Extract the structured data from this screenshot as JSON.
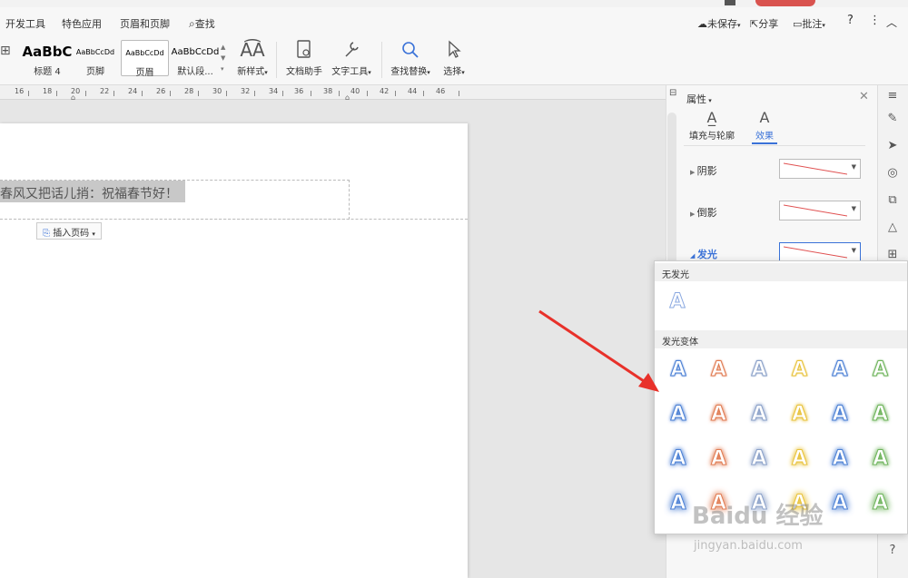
{
  "menu": {
    "items": [
      "开发工具",
      "特色应用",
      "页眉和页脚",
      "查找"
    ],
    "right": {
      "unsaved": "未保存",
      "share": "分享",
      "comment": "批注"
    }
  },
  "ribbon": {
    "styles": [
      {
        "sample": "AaBbC",
        "label": "标题 4"
      },
      {
        "sample": "AaBbCcDd",
        "label": "页脚"
      },
      {
        "sample": "AaBbCcDd",
        "label": "页眉"
      },
      {
        "sample": "AaBbCcDd",
        "label": "默认段..."
      }
    ],
    "tools": {
      "new_style": "新样式",
      "doc_assistant": "文档助手",
      "text_tools": "文字工具",
      "find_replace": "查找替换",
      "select": "选择"
    }
  },
  "ruler": {
    "ticks": [
      "16",
      "18",
      "20",
      "22",
      "24",
      "26",
      "28",
      "30",
      "32",
      "34",
      "36",
      "38",
      "40",
      "42",
      "44",
      "46"
    ]
  },
  "document": {
    "header_text": "春风又把话儿捎：祝福春节好！",
    "insert_page_number": "插入页码"
  },
  "panel": {
    "title": "属性",
    "tabs": [
      "填充与轮廓",
      "效果"
    ],
    "props": [
      "阴影",
      "倒影",
      "发光"
    ]
  },
  "glow_dropdown": {
    "no_glow": "无发光",
    "variants": "发光变体",
    "colors": [
      "#4a7fd4",
      "#e07a50",
      "#8aa0c8",
      "#e8c23a",
      "#4a7fd4",
      "#6db35a"
    ]
  },
  "watermark": {
    "main": "Baidu 经验",
    "sub": "jingyan.baidu.com"
  }
}
